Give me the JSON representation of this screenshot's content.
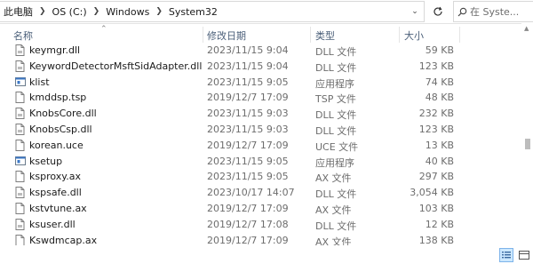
{
  "address": {
    "crumbs": [
      "此电脑",
      "OS (C:)",
      "Windows",
      "System32"
    ]
  },
  "search": {
    "placeholder": "在 Syste..."
  },
  "columns": {
    "name": "名称",
    "date": "修改日期",
    "type": "类型",
    "size": "大小"
  },
  "files": [
    {
      "name": "keymgr.dll",
      "date": "2023/11/15 9:04",
      "type": "DLL 文件",
      "size": "59 KB",
      "icon": "dll-file-icon"
    },
    {
      "name": "KeywordDetectorMsftSidAdapter.dll",
      "date": "2023/11/15 9:04",
      "type": "DLL 文件",
      "size": "123 KB",
      "icon": "dll-file-icon"
    },
    {
      "name": "klist",
      "date": "2023/11/15 9:05",
      "type": "应用程序",
      "size": "74 KB",
      "icon": "application-icon"
    },
    {
      "name": "kmddsp.tsp",
      "date": "2019/12/7 17:09",
      "type": "TSP 文件",
      "size": "48 KB",
      "icon": "file-icon"
    },
    {
      "name": "KnobsCore.dll",
      "date": "2023/11/15 9:03",
      "type": "DLL 文件",
      "size": "232 KB",
      "icon": "dll-file-icon"
    },
    {
      "name": "KnobsCsp.dll",
      "date": "2023/11/15 9:03",
      "type": "DLL 文件",
      "size": "123 KB",
      "icon": "dll-file-icon"
    },
    {
      "name": "korean.uce",
      "date": "2019/12/7 17:09",
      "type": "UCE 文件",
      "size": "13 KB",
      "icon": "file-icon"
    },
    {
      "name": "ksetup",
      "date": "2023/11/15 9:05",
      "type": "应用程序",
      "size": "40 KB",
      "icon": "application-icon"
    },
    {
      "name": "ksproxy.ax",
      "date": "2023/11/15 9:05",
      "type": "AX 文件",
      "size": "297 KB",
      "icon": "file-icon"
    },
    {
      "name": "kspsafe.dll",
      "date": "2023/10/17 14:07",
      "type": "DLL 文件",
      "size": "3,054 KB",
      "icon": "dll-file-icon"
    },
    {
      "name": "kstvtune.ax",
      "date": "2019/12/7 17:09",
      "type": "AX 文件",
      "size": "103 KB",
      "icon": "file-icon"
    },
    {
      "name": "ksuser.dll",
      "date": "2019/12/7 17:08",
      "type": "DLL 文件",
      "size": "12 KB",
      "icon": "dll-file-icon"
    },
    {
      "name": "Kswdmcap.ax",
      "date": "2019/12/7 17:09",
      "type": "AX 文件",
      "size": "138 KB",
      "icon": "file-icon"
    }
  ],
  "colors": {
    "selected_view": "#cce8ff",
    "header_text": "#4c607a",
    "muted_text": "#6d6d6d"
  }
}
